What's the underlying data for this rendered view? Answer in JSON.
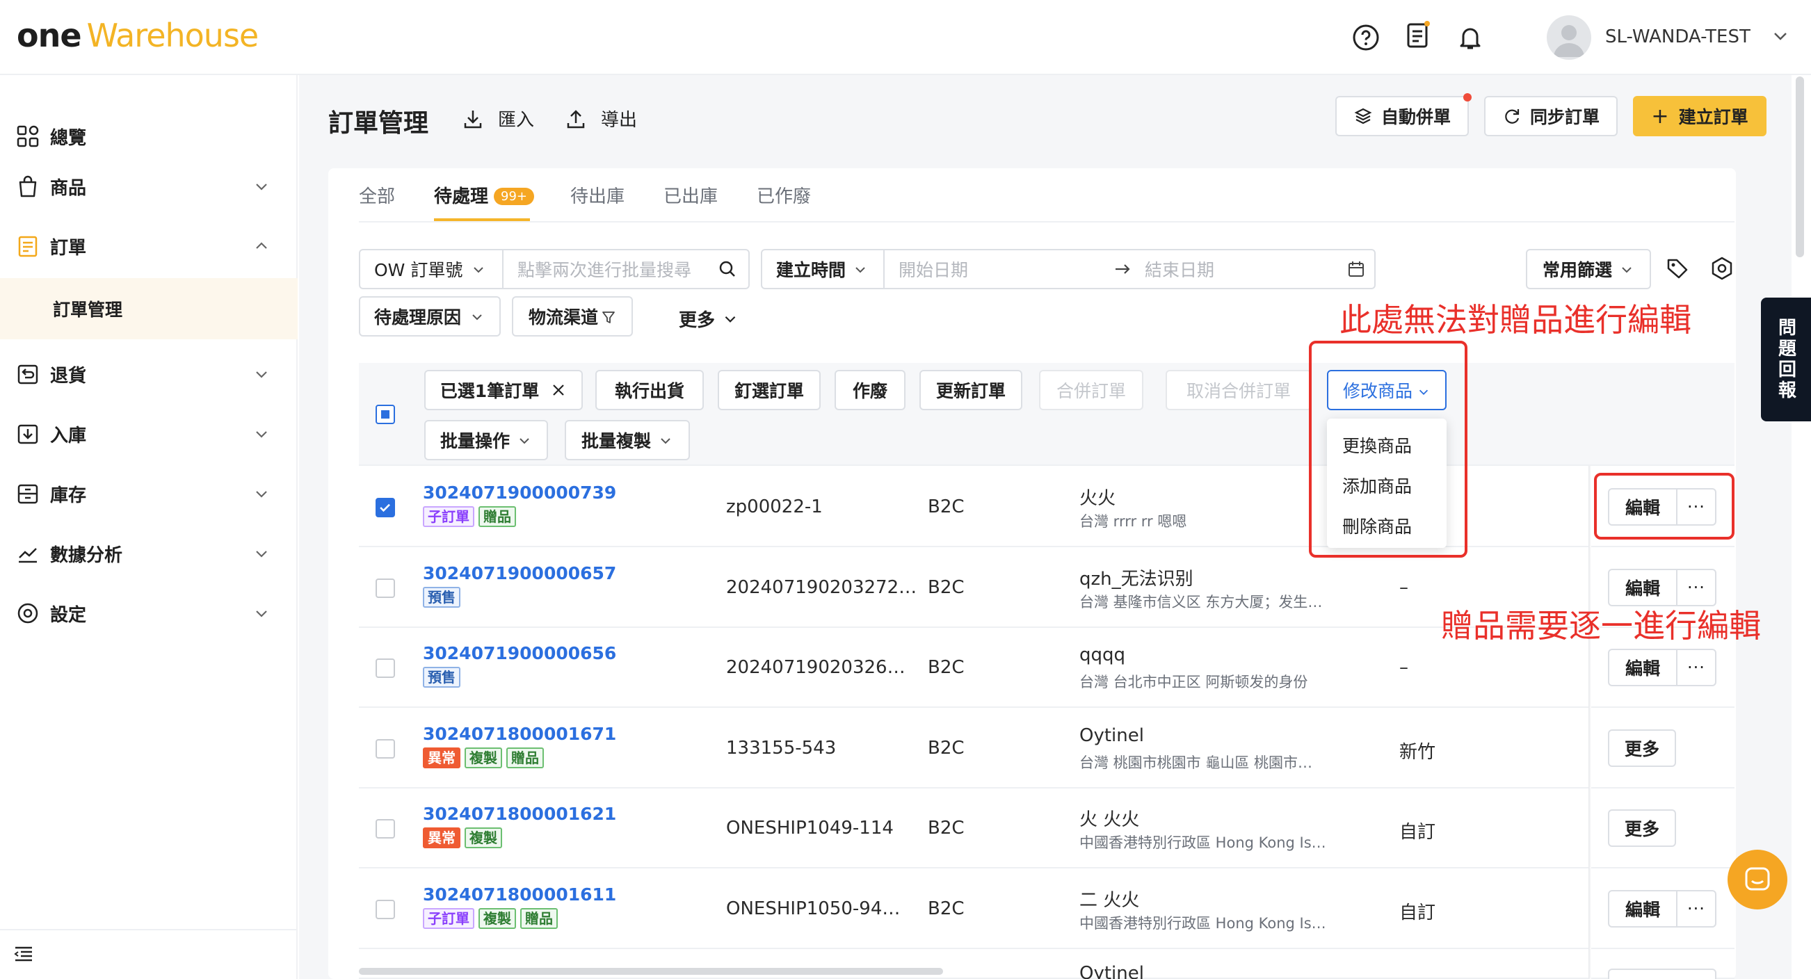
{
  "brand": {
    "part1": "one",
    "part2": "Warehouse"
  },
  "header": {
    "username": "SL-WANDA-TEST"
  },
  "sidebar": {
    "items": [
      {
        "label": "總覽"
      },
      {
        "label": "商品"
      },
      {
        "label": "訂單"
      },
      {
        "label": "訂單管理"
      },
      {
        "label": "退貨"
      },
      {
        "label": "入庫"
      },
      {
        "label": "庫存"
      },
      {
        "label": "數據分析"
      },
      {
        "label": "設定"
      }
    ]
  },
  "page": {
    "title": "訂單管理",
    "import_label": "匯入",
    "export_label": "導出",
    "auto_merge_label": "自動併單",
    "sync_label": "同步訂單",
    "create_label": "建立訂單"
  },
  "tabs": [
    {
      "label": "全部"
    },
    {
      "label": "待處理",
      "badge": "99+"
    },
    {
      "label": "待出庫"
    },
    {
      "label": "已出庫"
    },
    {
      "label": "已作廢"
    }
  ],
  "filters": {
    "order_type": "OW 訂單號",
    "search_placeholder": "點擊兩次進行批量搜尋",
    "time_type": "建立時間",
    "start_placeholder": "開始日期",
    "end_placeholder": "結束日期",
    "common_filter": "常用篩選",
    "reason": "待處理原因",
    "logistics": "物流渠道",
    "more": "更多"
  },
  "toolbar": {
    "selected": "已選1筆訂單",
    "ship": "執行出貨",
    "pin": "釘選訂單",
    "void": "作廢",
    "update": "更新訂單",
    "merge": "合併訂單",
    "unmerge": "取消合併訂單",
    "modify": "修改商品",
    "batch_ops": "批量操作",
    "batch_copy": "批量複製"
  },
  "dropdown": {
    "items": [
      "更換商品",
      "添加商品",
      "刪除商品"
    ]
  },
  "annotations": {
    "note1": "此處無法對贈品進行編輯",
    "note2": "贈品需要逐一進行編輯"
  },
  "rows": [
    {
      "id": "3024071900000739",
      "tags": [
        "子訂單",
        "贈品"
      ],
      "ref": "zp00022-1",
      "type": "B2C",
      "name": "火火",
      "addr": "台灣 rrrr rr 嗯嗯",
      "extra": "",
      "action": "編輯",
      "checked": true
    },
    {
      "id": "3024071900000657",
      "tags": [
        "預售"
      ],
      "ref": "202407190203272…",
      "type": "B2C",
      "name": "qzh_无法识别",
      "addr": "台灣 基隆市信义区 东方大厦；发生…",
      "extra": "–",
      "action": "編輯",
      "checked": false
    },
    {
      "id": "3024071900000656",
      "tags": [
        "預售"
      ],
      "ref": "20240719020326…",
      "type": "B2C",
      "name": "qqqq",
      "addr": "台灣 台北市中正区 阿斯顿发的身份",
      "extra": "–",
      "action": "編輯",
      "checked": false
    },
    {
      "id": "3024071800001671",
      "tags": [
        "異常",
        "複製",
        "贈品"
      ],
      "ref": "133155-543",
      "type": "B2C",
      "name": "Oytinel",
      "addr": "台灣 桃園市桃園市 龜山區 桃園市…",
      "extra": "新竹",
      "action": "更多",
      "checked": false
    },
    {
      "id": "3024071800001621",
      "tags": [
        "異常",
        "複製"
      ],
      "ref": "ONESHIP1049-114",
      "type": "B2C",
      "name": "火 火火",
      "addr": "中國香港特別行政區 Hong Kong Is…",
      "extra": "自訂",
      "action": "更多",
      "checked": false
    },
    {
      "id": "3024071800001611",
      "tags": [
        "子訂單",
        "複製",
        "贈品"
      ],
      "ref": "ONESHIP1050-94…",
      "type": "B2C",
      "name": "二 火火",
      "addr": "中國香港特別行政區 Hong Kong Is…",
      "extra": "自訂",
      "action": "編輯",
      "checked": false
    }
  ],
  "partial_row": {
    "name": "Oytinel"
  },
  "feedback": {
    "label": "問題回報"
  }
}
